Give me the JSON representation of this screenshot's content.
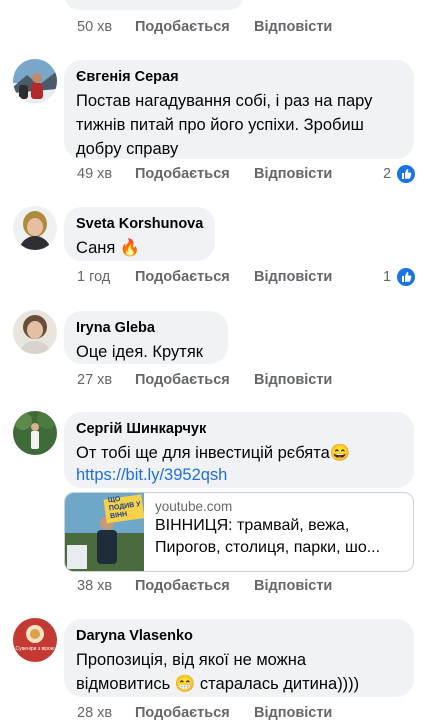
{
  "comments": [
    {
      "time": "50 хв",
      "like_label": "Подобається",
      "reply_label": "Відповісти"
    },
    {
      "author": "Євгенія Серая",
      "text": "Постав нагадування собі, і раз на пару тижнів питай про його успіхи. Зробиш добру справу",
      "time": "49 хв",
      "like_label": "Подобається",
      "reply_label": "Відповісти",
      "reactions": "2"
    },
    {
      "author": "Sveta Korshunova",
      "text": "Саня 🔥",
      "time": "1 год",
      "like_label": "Подобається",
      "reply_label": "Відповісти",
      "reactions": "1"
    },
    {
      "author": "Iryna Gleba",
      "text": "Оце ідея. Крутяк",
      "time": "27 хв",
      "like_label": "Подобається",
      "reply_label": "Відповісти"
    },
    {
      "author": "Сергій Шинкарчук",
      "text": "От тобі ще для інвестицій рєбята😄",
      "link": "https://bit.ly/3952qsh",
      "time": "38 хв",
      "like_label": "Подобається",
      "reply_label": "Відповісти",
      "preview": {
        "domain": "youtube.com",
        "title": "ВІННИЦЯ: трамвай, вежа, Пирогов, столиця, парки, шо...",
        "thumb_text": "ЩО ПОДИВ У ВІНН"
      }
    },
    {
      "author": "Daryna Vlasenko",
      "text": "Пропозиція, від якої не можна відмовитись 😁 старалась дитина))))",
      "time": "28 хв",
      "like_label": "Подобається",
      "reply_label": "Відповісти",
      "avatar_text": "Сувеніри з вірою"
    }
  ],
  "colors": {
    "bubble": "#f0f2f5",
    "meta": "#65676b",
    "link": "#216fdb",
    "like": "#1b74e4"
  }
}
